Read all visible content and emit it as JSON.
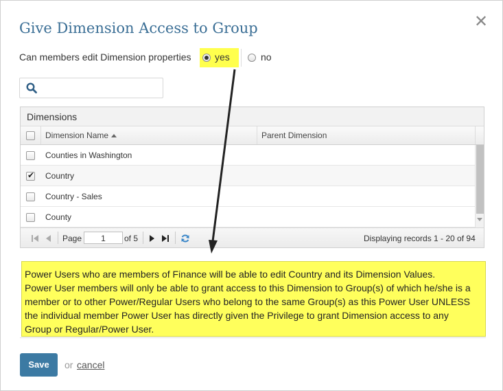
{
  "dialog": {
    "title": "Give Dimension Access to Group",
    "close_icon": "close-icon"
  },
  "edit_properties": {
    "label": "Can members edit Dimension properties",
    "options": [
      {
        "label": "yes",
        "selected": true
      },
      {
        "label": "no",
        "selected": false
      }
    ],
    "highlight_color": "#ffff4d"
  },
  "search": {
    "icon": "search-icon",
    "value": ""
  },
  "grid": {
    "title": "Dimensions",
    "columns": [
      "Dimension Name",
      "Parent Dimension"
    ],
    "sort": "ascending",
    "rows": [
      {
        "name": "Counties in Washington",
        "parent": "",
        "checked": false
      },
      {
        "name": "Country",
        "parent": "",
        "checked": true
      },
      {
        "name": "Country - Sales",
        "parent": "",
        "checked": false
      },
      {
        "name": "County",
        "parent": "",
        "checked": false
      }
    ],
    "pager": {
      "page_label": "Page",
      "page_value": "1",
      "of_label": "of 5",
      "status": "Displaying records 1 - 20 of 94"
    }
  },
  "note": {
    "lines": [
      "Power Users who are members of Finance will be able to edit Country and its Dimension Values.",
      "Power User members will only be able to grant access to this Dimension to Group(s) of which he/she is a",
      "member or to other Power/Regular Users who belong to the same Group(s) as this Power User UNLESS",
      "the individual member Power User has directly given the Privilege to grant Dimension access to any",
      "Group or Regular/Power User."
    ],
    "background": "#ffff5c"
  },
  "footer": {
    "save_label": "Save",
    "or_label": "or",
    "cancel_label": "cancel",
    "accent": "#3c7aa3"
  }
}
